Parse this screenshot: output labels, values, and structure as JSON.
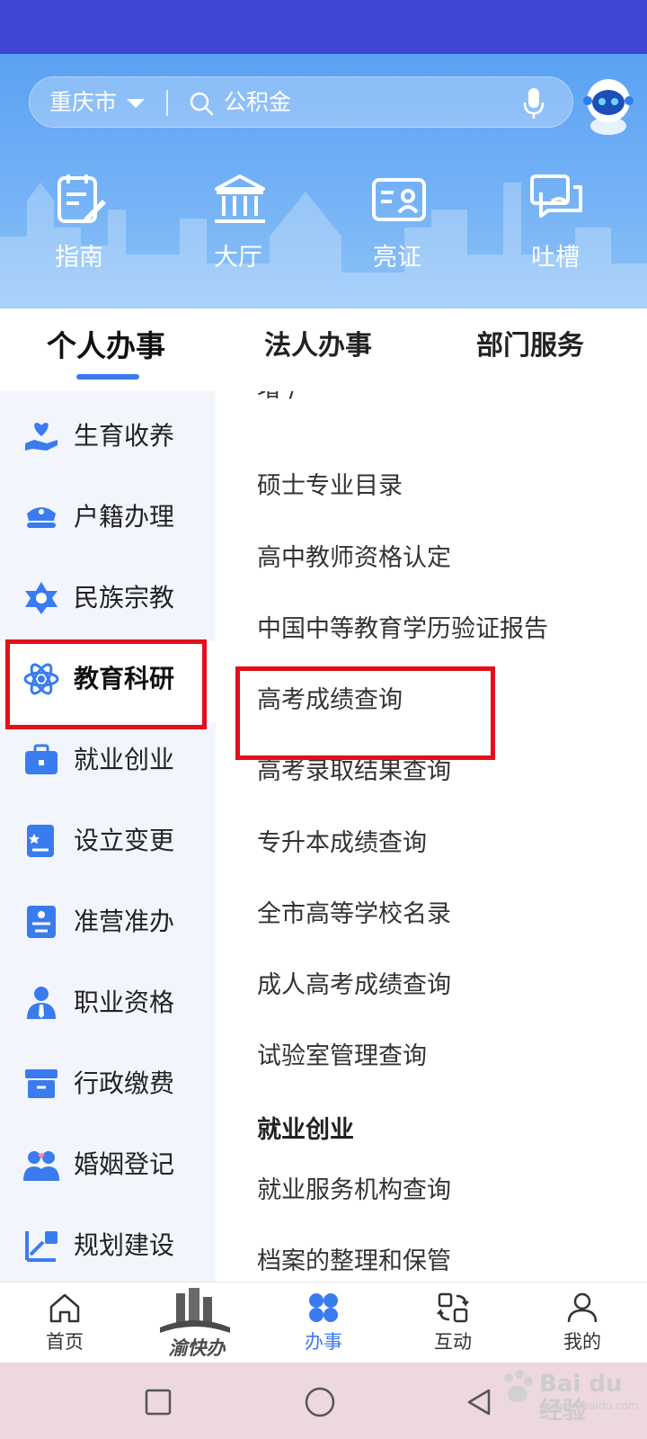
{
  "search": {
    "city": "重庆市",
    "placeholder": "公积金"
  },
  "quick_actions": [
    {
      "label": "指南",
      "icon": "guide-icon"
    },
    {
      "label": "大厅",
      "icon": "hall-icon"
    },
    {
      "label": "亮证",
      "icon": "id-card-icon"
    },
    {
      "label": "吐槽",
      "icon": "feedback-icon"
    }
  ],
  "tabs": [
    {
      "label": "个人办事",
      "active": true
    },
    {
      "label": "法人办事",
      "active": false
    },
    {
      "label": "部门服务",
      "active": false
    }
  ],
  "sidebar": {
    "items": [
      {
        "label": "生育收养",
        "icon": "childcare-icon"
      },
      {
        "label": "户籍办理",
        "icon": "police-cap-icon"
      },
      {
        "label": "民族宗教",
        "icon": "star-emblem-icon"
      },
      {
        "label": "教育科研",
        "icon": "atom-icon",
        "active": true
      },
      {
        "label": "就业创业",
        "icon": "briefcase-icon"
      },
      {
        "label": "设立变更",
        "icon": "registration-icon"
      },
      {
        "label": "准营准办",
        "icon": "permit-icon"
      },
      {
        "label": "职业资格",
        "icon": "professional-icon"
      },
      {
        "label": "行政缴费",
        "icon": "payment-box-icon"
      },
      {
        "label": "婚姻登记",
        "icon": "marriage-icon"
      },
      {
        "label": "规划建设",
        "icon": "planning-icon"
      }
    ]
  },
  "list": {
    "cut_top": "增 /",
    "items": [
      "硕士专业目录",
      "高中教师资格认定",
      "中国中等教育学历验证报告",
      "高考成绩查询",
      "高考录取结果查询",
      "专升本成绩查询",
      "全市高等学校名录",
      "成人高考成绩查询",
      "试验室管理查询"
    ],
    "section_heading": "就业创业",
    "section_items": [
      "就业服务机构查询",
      "档案的整理和保管"
    ]
  },
  "bottom_nav": [
    {
      "label": "首页",
      "icon": "home-icon"
    },
    {
      "label": "渝快办",
      "icon": "brand-logo"
    },
    {
      "label": "办事",
      "icon": "services-icon",
      "active": true
    },
    {
      "label": "互动",
      "icon": "interact-icon"
    },
    {
      "label": "我的",
      "icon": "profile-icon"
    }
  ],
  "watermark": {
    "text": "Bai du 经验",
    "sub": "jingyan.baidu.com"
  },
  "colors": {
    "status_bar": "#4045d4",
    "accent": "#3a7bf0",
    "highlight": "#e1101a"
  }
}
